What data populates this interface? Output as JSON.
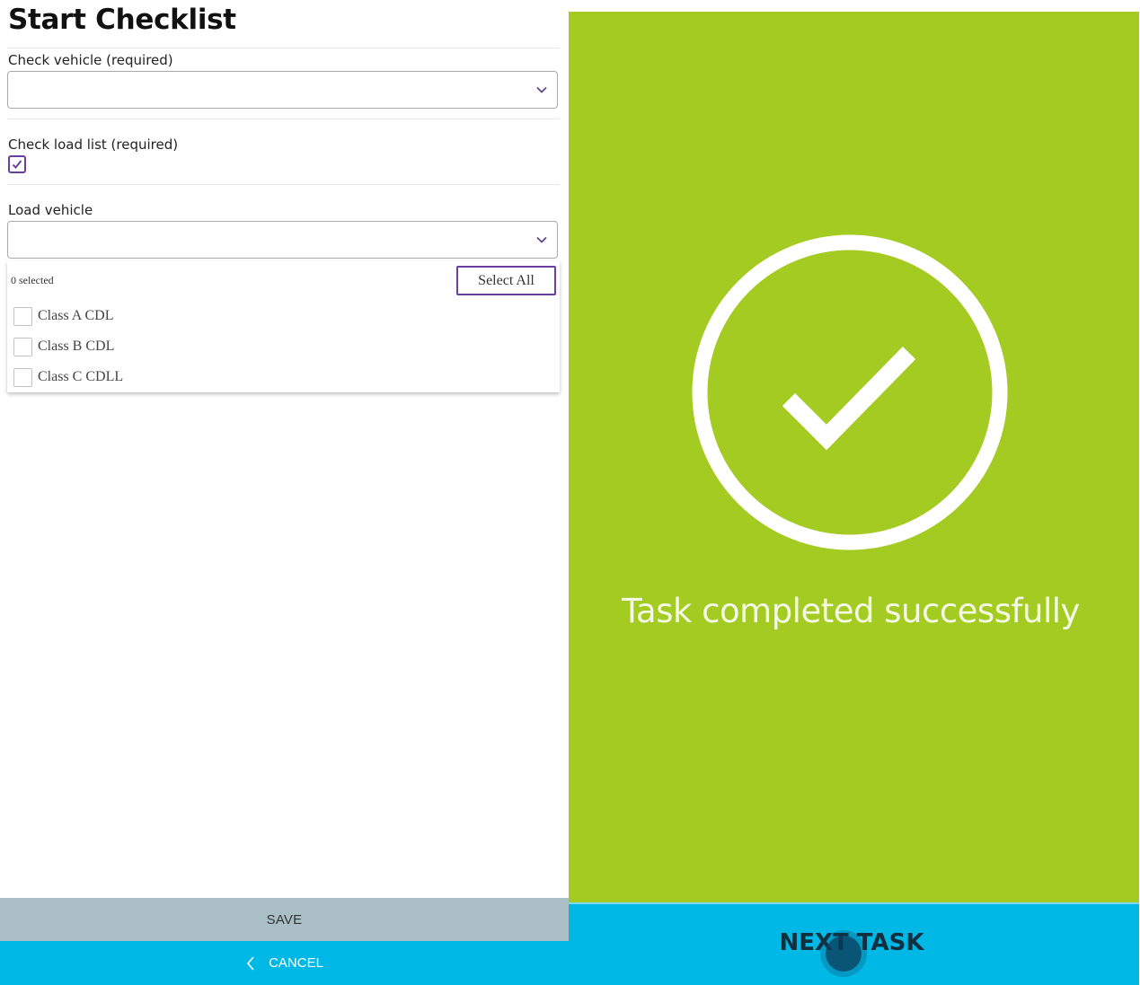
{
  "checklist": {
    "title": "Start Checklist",
    "check_vehicle": {
      "label": "Check vehicle (required)",
      "value": ""
    },
    "check_load_list": {
      "label": "Check load list (required)",
      "checked": true
    },
    "load_vehicle": {
      "label": "Load vehicle",
      "value": "",
      "selected_count": "0 selected",
      "select_all_label": "Select All",
      "options": [
        {
          "label": "Class A CDL",
          "checked": false
        },
        {
          "label": "Class B CDL",
          "checked": false
        },
        {
          "label": "Class C CDLL",
          "checked": false
        }
      ]
    },
    "save_label": "SAVE",
    "cancel_label": "CANCEL"
  },
  "completion": {
    "message": "Task completed successfully",
    "next_label": "NEXT TASK",
    "icon": "check-circle-icon"
  },
  "colors": {
    "accent_purple": "#6b3fa0",
    "success_green": "#a4cb21",
    "action_blue": "#00b8e6",
    "save_gray": "#aabfc6"
  }
}
